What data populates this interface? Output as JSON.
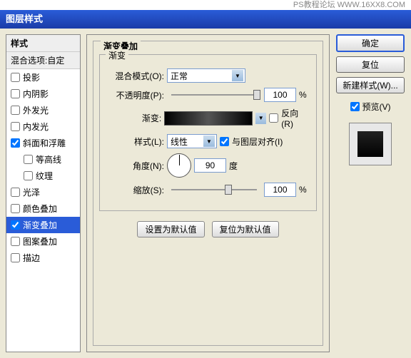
{
  "topbar": "PS教程论坛 WWW.16XX8.COM",
  "title": "图层样式",
  "styles": {
    "header": "样式",
    "blend_header": "混合选项:自定",
    "items": [
      {
        "label": "投影",
        "checked": false
      },
      {
        "label": "内阴影",
        "checked": false
      },
      {
        "label": "外发光",
        "checked": false
      },
      {
        "label": "内发光",
        "checked": false
      },
      {
        "label": "斜面和浮雕",
        "checked": true
      },
      {
        "label": "等高线",
        "checked": false,
        "indent": true
      },
      {
        "label": "纹理",
        "checked": false,
        "indent": true
      },
      {
        "label": "光泽",
        "checked": false
      },
      {
        "label": "颜色叠加",
        "checked": false
      },
      {
        "label": "渐变叠加",
        "checked": true,
        "selected": true
      },
      {
        "label": "图案叠加",
        "checked": false
      },
      {
        "label": "描边",
        "checked": false
      }
    ]
  },
  "panel": {
    "title": "渐变叠加",
    "fieldset_label": "渐变",
    "blend_mode_label": "混合模式(O):",
    "blend_mode_value": "正常",
    "opacity_label": "不透明度(P):",
    "opacity_value": "100",
    "opacity_unit": "%",
    "gradient_label": "渐变:",
    "reverse_label": "反向(R)",
    "style_label": "样式(L):",
    "style_value": "线性",
    "align_label": "与图层对齐(I)",
    "angle_label": "角度(N):",
    "angle_value": "90",
    "angle_unit": "度",
    "scale_label": "缩放(S):",
    "scale_value": "100",
    "scale_unit": "%",
    "default_btn": "设置为默认值",
    "reset_btn": "复位为默认值"
  },
  "right": {
    "ok": "确定",
    "cancel": "复位",
    "new_style": "新建样式(W)...",
    "preview": "预览(V)"
  }
}
